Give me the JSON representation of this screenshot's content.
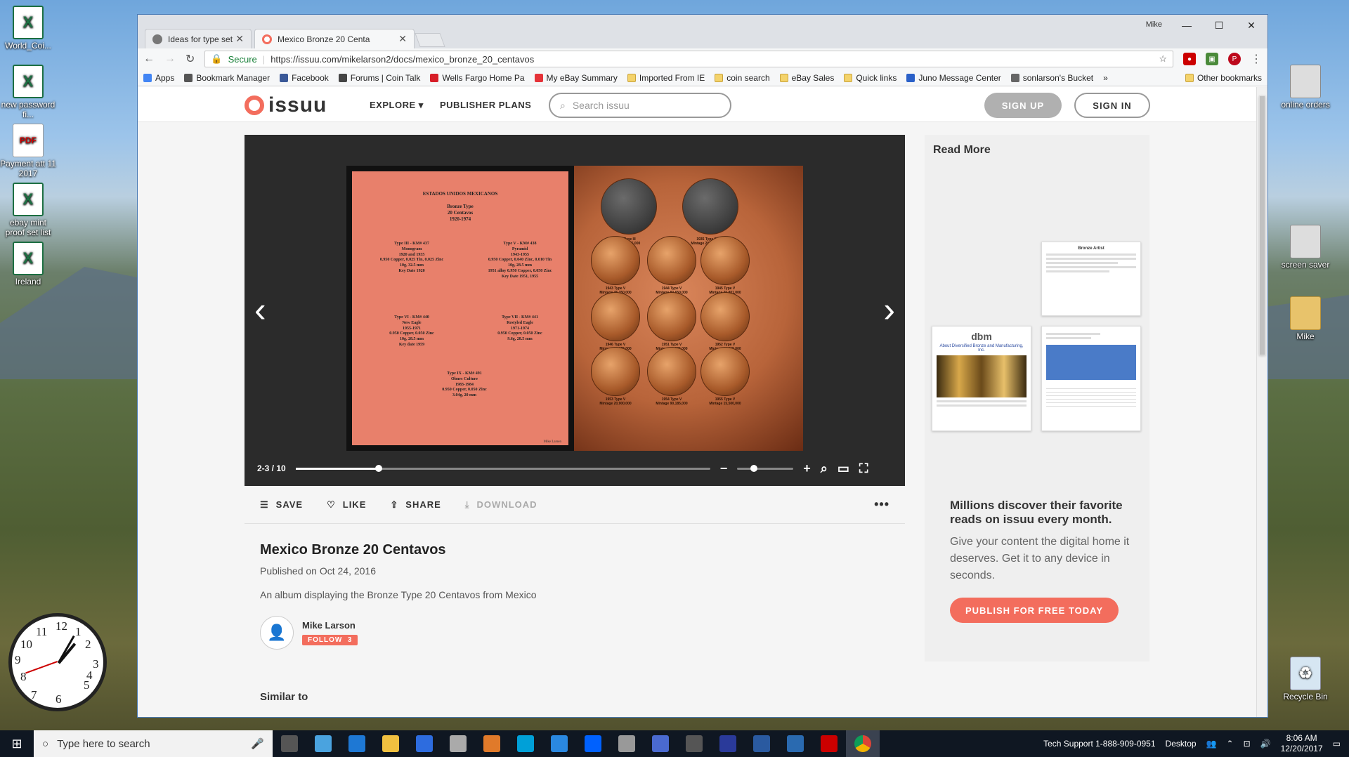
{
  "desktop": {
    "icons_left": [
      {
        "label": "World_Coi...",
        "type": "excel"
      },
      {
        "label": "new password fi...",
        "type": "excel"
      },
      {
        "label": "Payment att 11 2017",
        "type": "pdf"
      },
      {
        "label": "ebay mint proof set list",
        "type": "excel"
      },
      {
        "label": "Ireland",
        "type": "excel"
      }
    ],
    "icons_right": [
      {
        "label": "online orders",
        "type": "file"
      },
      {
        "label": "screen saver",
        "type": "file"
      },
      {
        "label": "Mike",
        "type": "folder"
      },
      {
        "label": "Recycle Bin",
        "type": "recycle"
      }
    ]
  },
  "browser": {
    "profile": "Mike",
    "tabs": [
      {
        "title": "Ideas for type set album",
        "active": false,
        "favicon_color": "#777777"
      },
      {
        "title": "Mexico Bronze 20 Centa",
        "active": true,
        "favicon_color": "#f36d5d"
      }
    ],
    "window_controls": {
      "minimize": "—",
      "maximize": "☐",
      "close": "✕"
    },
    "secure_label": "Secure",
    "url": "https://issuu.com/mikelarson2/docs/mexico_bronze_20_centavos",
    "bookmarks": [
      {
        "label": "Apps",
        "icon": "apps-grid-icon"
      },
      {
        "label": "Bookmark Manager",
        "icon": "star-icon"
      },
      {
        "label": "Facebook",
        "icon": "facebook-icon"
      },
      {
        "label": "Forums | Coin Talk",
        "icon": "cointalk-icon"
      },
      {
        "label": "Wells Fargo Home Pa",
        "icon": "wellsfargo-icon"
      },
      {
        "label": "My eBay Summary",
        "icon": "ebay-icon"
      },
      {
        "label": "Imported From IE",
        "icon": "folder-icon"
      },
      {
        "label": "coin search",
        "icon": "folder-icon"
      },
      {
        "label": "eBay Sales",
        "icon": "folder-icon"
      },
      {
        "label": "Quick links",
        "icon": "folder-icon"
      },
      {
        "label": "Juno Message Center",
        "icon": "juno-icon"
      },
      {
        "label": "sonlarson's Bucket",
        "icon": "bucket-icon"
      }
    ],
    "bookmarks_overflow": "»",
    "other_bookmarks": "Other bookmarks"
  },
  "site": {
    "logo_text": "issuu",
    "nav": {
      "explore": "EXPLORE",
      "publisher_plans": "PUBLISHER PLANS"
    },
    "search_placeholder": "Search issuu",
    "sign_up": "SIGN UP",
    "sign_in": "SIGN IN"
  },
  "reader": {
    "page_counter": "2-3 / 10",
    "progress_fraction": 0.2,
    "zoom_fraction": 0.3,
    "left_page": {
      "heading": "ESTADOS UNIDOS MEXICANOS",
      "subheading": [
        "Bronze Type",
        "20 Centavos",
        "1920-1974"
      ],
      "blocks": [
        {
          "lines": [
            "Type III - KM# 437",
            "Monogram",
            "1920 and 1935",
            "0.950 Copper, 0.025 Tin, 0.025 Zinc",
            "10g, 32.5 mm",
            "Key Date 1920"
          ]
        },
        {
          "lines": [
            "Type V - KM# 438",
            "Pyramid",
            "1943-1955",
            "0.950 Copper, 0.040 Zinc, 0.010 Tin",
            "10g, 28.5 mm",
            "1951 alloy 0.950 Copper, 0.050 Zinc",
            "Key Date 1951, 1955"
          ]
        },
        {
          "lines": [
            "Type VI - KM# 440",
            "New Eagle",
            "1955-1971",
            "0.950 Copper, 0.050 Zinc",
            "10g, 28.5 mm",
            "Key date 1959"
          ]
        },
        {
          "lines": [
            "Type VII - KM# 441",
            "Restyled Eagle",
            "1971-1974",
            "0.950 Copper, 0.050 Zinc",
            "9.6g, 28.5 mm"
          ]
        },
        {
          "lines": [
            "Type IX - KM# 491",
            "Olmec Culture",
            "1983-1984",
            "0.950 Copper, 0.050 Zinc",
            "3.04g, 20 mm"
          ]
        }
      ],
      "credit": "Mike Larsen"
    },
    "right_page": {
      "coins": [
        {
          "caption": "1920 Type III",
          "sub": "Mintage 4,835,000",
          "tone": "dark"
        },
        {
          "caption": "1935 Type III",
          "sub": "Mintage 20,000,000",
          "tone": "dark"
        },
        {
          "caption": "1943 Type V",
          "sub": "Mintage 46,350,000",
          "tone": "bronze"
        },
        {
          "caption": "1944 Type V",
          "sub": "Mintage 83,650,000",
          "tone": "bronze"
        },
        {
          "caption": "1945 Type V",
          "sub": "Mintage 26,801,000",
          "tone": "bronze"
        },
        {
          "caption": "1946 Type V",
          "sub": "Mintage 25,695,000",
          "tone": "bronze"
        },
        {
          "caption": "1951 Type V",
          "sub": "Mintage 11,385,000",
          "tone": "bronze"
        },
        {
          "caption": "1952 Type V",
          "sub": "Mintage 14,615,000",
          "tone": "bronze"
        },
        {
          "caption": "1953 Type V",
          "sub": "Mintage 20,900,000",
          "tone": "bronze"
        },
        {
          "caption": "1954 Type V",
          "sub": "Mintage 90,185,000",
          "tone": "bronze"
        },
        {
          "caption": "1955 Type V",
          "sub": "Mintage 15,500,000",
          "tone": "bronze"
        }
      ]
    }
  },
  "actions": {
    "save": "SAVE",
    "like": "LIKE",
    "share": "SHARE",
    "download": "DOWNLOAD",
    "more": "•••"
  },
  "document": {
    "title": "Mexico Bronze 20 Centavos",
    "published": "Published on Oct 24, 2016",
    "description": "An album displaying the Bronze Type 20 Centavos from Mexico",
    "author": "Mike Larson",
    "follow_label": "FOLLOW",
    "follow_count": "3"
  },
  "sidebar": {
    "read_more": "Read More",
    "thumb1_title": "Bronze Artist",
    "thumb2_brand": "dbm",
    "thumb2_caption": "About Diversified Bronze and Manufacturing, Inc.",
    "promo_heading": "Millions discover their favorite reads on issuu every month.",
    "promo_text": "Give your content the digital home it deserves. Get it to any device in seconds.",
    "publish_button": "PUBLISH FOR FREE TODAY"
  },
  "similar_label": "Similar to",
  "taskbar": {
    "search_placeholder": "Type here to search",
    "support": "Tech Support  1-888-909-0951",
    "desktop_label": "Desktop",
    "time": "8:06 AM",
    "date": "12/20/2017",
    "pinned": [
      "task-view",
      "app",
      "edge",
      "file-explorer",
      "store",
      "app",
      "app",
      "skype",
      "app",
      "dropbox",
      "app",
      "app",
      "app",
      "app",
      "app",
      "app",
      "app",
      "chrome"
    ]
  },
  "colors": {
    "accent": "#f36d5d",
    "reader_bg": "#2b2b2b",
    "taskbar": "#0f1722"
  }
}
